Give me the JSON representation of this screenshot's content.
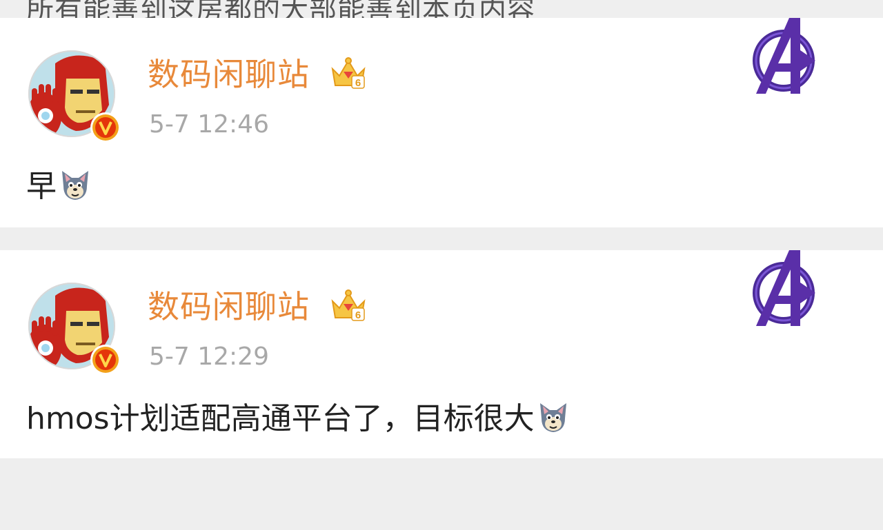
{
  "top_partial_text": "所有能善到这房都的大部能善到本页内容",
  "colors": {
    "username": "#e8893a",
    "timestamp": "#a8a8a8",
    "post_text": "#222222",
    "background": "#eeeeee",
    "card": "#ffffff",
    "verified_badge": "#e4360a",
    "avengers_purple": "#5a2fa8"
  },
  "posts": [
    {
      "username": "数码闲聊站",
      "level_badge": "6",
      "timestamp": "5-7 12:46",
      "text": "早",
      "avatar_icon": "iron-man-avatar",
      "verified_icon": "verified-v-badge",
      "decoration_icon": "avengers-logo",
      "emoji_icon": "tom-cat-emoji"
    },
    {
      "username": "数码闲聊站",
      "level_badge": "6",
      "timestamp": "5-7 12:29",
      "text": "hmos计划适配高通平台了，目标很大",
      "avatar_icon": "iron-man-avatar",
      "verified_icon": "verified-v-badge",
      "decoration_icon": "avengers-logo",
      "emoji_icon": "tom-cat-emoji"
    }
  ]
}
